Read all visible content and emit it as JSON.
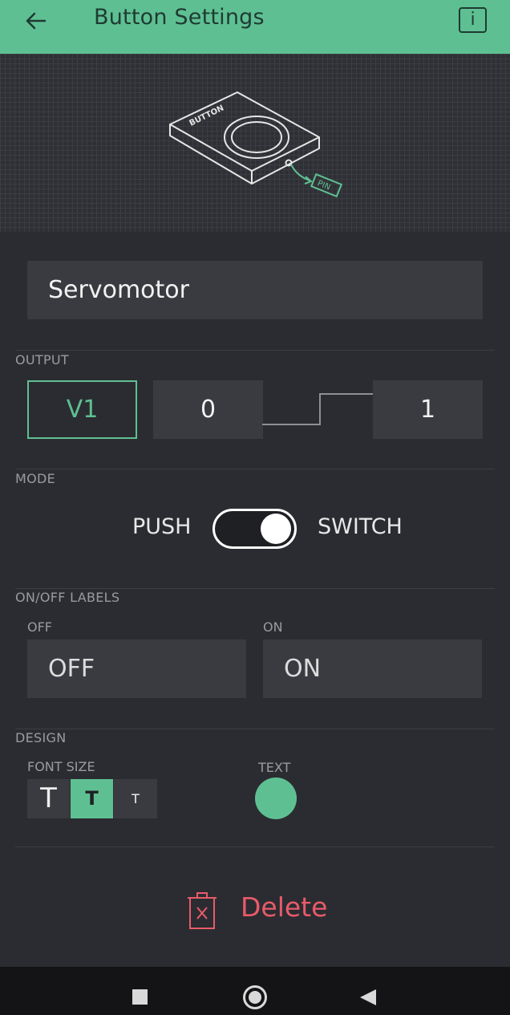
{
  "header": {
    "title": "Button Settings",
    "back_icon": "arrow-left-icon",
    "info_label": "i",
    "background_color": "#5ec092"
  },
  "hero": {
    "button_label": "BUTTON",
    "pin_label": "PIN"
  },
  "widget_name": {
    "value": "Servomotor"
  },
  "output": {
    "section_label": "OUTPUT",
    "pin": "V1",
    "min_value": "0",
    "max_value": "1"
  },
  "mode": {
    "section_label": "MODE",
    "left_label": "PUSH",
    "right_label": "SWITCH",
    "selected": "SWITCH"
  },
  "labels": {
    "section_label": "ON/OFF LABELS",
    "off_caption": "OFF",
    "off_value": "OFF",
    "on_caption": "ON",
    "on_value": "ON"
  },
  "design": {
    "section_label": "DESIGN",
    "font_size_label": "FONT SIZE",
    "font_sizes": [
      "T",
      "T",
      "T"
    ],
    "selected_font_size_index": 1,
    "text_color_label": "TEXT",
    "text_color": "#5ec092"
  },
  "delete": {
    "label": "Delete",
    "icon": "trash-icon",
    "color": "#e85b6a"
  },
  "navbar": {
    "icons": [
      "recents-square-icon",
      "home-circle-icon",
      "back-triangle-icon"
    ]
  }
}
